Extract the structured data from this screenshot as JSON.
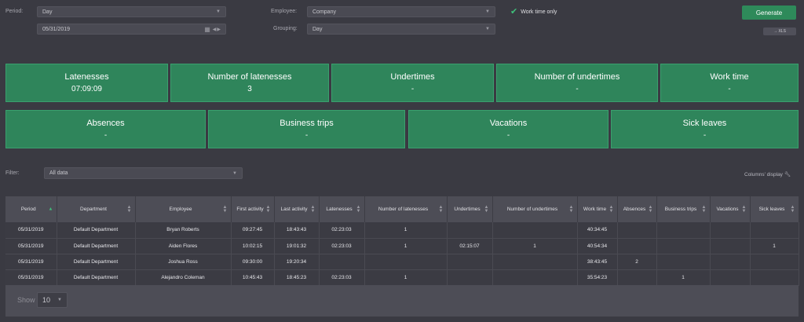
{
  "filters": {
    "period_label": "Period:",
    "period_value": "Day",
    "date_value": "05/31/2019",
    "employee_label": "Employee:",
    "employee_value": "Company",
    "grouping_label": "Grouping:",
    "grouping_value": "Day",
    "work_time_only_label": "Work time only",
    "generate_label": "Generate",
    "xls_label": "→ XLS"
  },
  "summary_row1": [
    {
      "title": "Latenesses",
      "value": "07:09:09"
    },
    {
      "title": "Number of latenesses",
      "value": "3"
    },
    {
      "title": "Undertimes",
      "value": "-"
    },
    {
      "title": "Number of undertimes",
      "value": "-"
    },
    {
      "title": "Work time",
      "value": "-"
    }
  ],
  "summary_row2": [
    {
      "title": "Absences",
      "value": "-"
    },
    {
      "title": "Business trips",
      "value": "-"
    },
    {
      "title": "Vacations",
      "value": "-"
    },
    {
      "title": "Sick leaves",
      "value": "-"
    }
  ],
  "data_filter": {
    "label": "Filter:",
    "value": "All data",
    "columns_display_label": "Columns' display"
  },
  "table": {
    "headers": [
      "Period",
      "Department",
      "Employee",
      "First activity",
      "Last activity",
      "Latenesses",
      "Number of latenesses",
      "Undertimes",
      "Number of undertimes",
      "Work time",
      "Absences",
      "Business trips",
      "Vacations",
      "Sick leaves"
    ],
    "rows": [
      [
        "05/31/2019",
        "Default Department",
        "Bryan Roberts",
        "09:27:45",
        "18:43:43",
        "02:23:03",
        "1",
        "",
        "",
        "40:34:45",
        "",
        "",
        "",
        ""
      ],
      [
        "05/31/2019",
        "Default Department",
        "Aiden Flores",
        "10:02:15",
        "19:01:32",
        "02:23:03",
        "1",
        "02:15:07",
        "1",
        "40:54:34",
        "",
        "",
        "",
        "1"
      ],
      [
        "05/31/2019",
        "Default Department",
        "Joshua Ross",
        "09:30:00",
        "19:20:34",
        "",
        "",
        "",
        "",
        "38:43:45",
        "2",
        "",
        "",
        ""
      ],
      [
        "05/31/2019",
        "Default Department",
        "Alejandro Coleman",
        "10:45:43",
        "18:45:23",
        "02:23:03",
        "1",
        "",
        "",
        "35:54:23",
        "",
        "1",
        "",
        ""
      ]
    ]
  },
  "pagination": {
    "show_label": "Show",
    "page_size": "10"
  },
  "colors": {
    "card_bg": "#2f855b",
    "accent": "#3fc07a",
    "page_bg": "#3a3a42"
  }
}
